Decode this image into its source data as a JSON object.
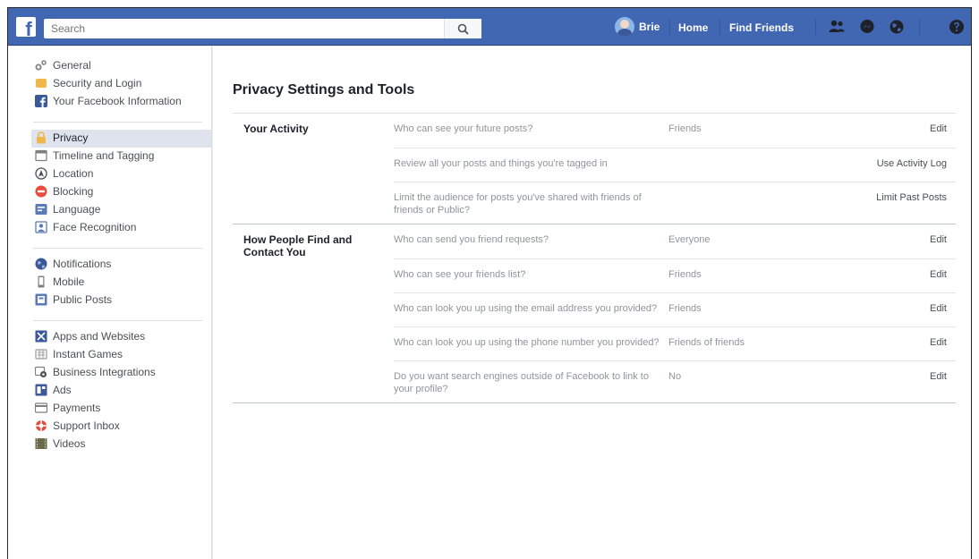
{
  "topbar": {
    "logo": "f",
    "search_placeholder": "Search",
    "user_name": "Brie",
    "home_label": "Home",
    "find_friends_label": "Find Friends"
  },
  "sidebar": {
    "group1": [
      {
        "label": "General",
        "icon": "gear-icon"
      },
      {
        "label": "Security and Login",
        "icon": "shield-icon"
      },
      {
        "label": "Your Facebook Information",
        "icon": "facebook-icon"
      }
    ],
    "group2": [
      {
        "label": "Privacy",
        "icon": "lock-icon"
      },
      {
        "label": "Timeline and Tagging",
        "icon": "timeline-icon"
      },
      {
        "label": "Location",
        "icon": "location-icon"
      },
      {
        "label": "Blocking",
        "icon": "blocking-icon"
      },
      {
        "label": "Language",
        "icon": "language-icon"
      },
      {
        "label": "Face Recognition",
        "icon": "face-recognition-icon"
      }
    ],
    "group3": [
      {
        "label": "Notifications",
        "icon": "globe-icon"
      },
      {
        "label": "Mobile",
        "icon": "mobile-icon"
      },
      {
        "label": "Public Posts",
        "icon": "public-posts-icon"
      }
    ],
    "group4": [
      {
        "label": "Apps and Websites",
        "icon": "apps-icon"
      },
      {
        "label": "Instant Games",
        "icon": "games-icon"
      },
      {
        "label": "Business Integrations",
        "icon": "business-icon"
      },
      {
        "label": "Ads",
        "icon": "ads-icon"
      },
      {
        "label": "Payments",
        "icon": "payments-icon"
      },
      {
        "label": "Support Inbox",
        "icon": "support-icon"
      },
      {
        "label": "Videos",
        "icon": "videos-icon"
      }
    ]
  },
  "main": {
    "title": "Privacy Settings and Tools",
    "sections": [
      {
        "title": "Your Activity",
        "rows": [
          {
            "question": "Who can see your future posts?",
            "value": "Friends",
            "action": "Edit"
          },
          {
            "question": "Review all your posts and things you're tagged in",
            "value": "",
            "action": "Use Activity Log"
          },
          {
            "question": "Limit the audience for posts you've shared with friends of friends or Public?",
            "value": "",
            "action": "Limit Past Posts"
          }
        ]
      },
      {
        "title": "How People Find and Contact You",
        "rows": [
          {
            "question": "Who can send you friend requests?",
            "value": "Everyone",
            "action": "Edit"
          },
          {
            "question": "Who can see your friends list?",
            "value": "Friends",
            "action": "Edit"
          },
          {
            "question": "Who can look you up using the email address you provided?",
            "value": "Friends",
            "action": "Edit"
          },
          {
            "question": "Who can look you up using the phone number you provided?",
            "value": "Friends of friends",
            "action": "Edit"
          },
          {
            "question": "Do you want search engines outside of Facebook to link to your profile?",
            "value": "No",
            "action": "Edit"
          }
        ]
      }
    ]
  },
  "colors": {
    "brand_blue": "#4267b2",
    "active_bg": "#dfe3ee"
  }
}
